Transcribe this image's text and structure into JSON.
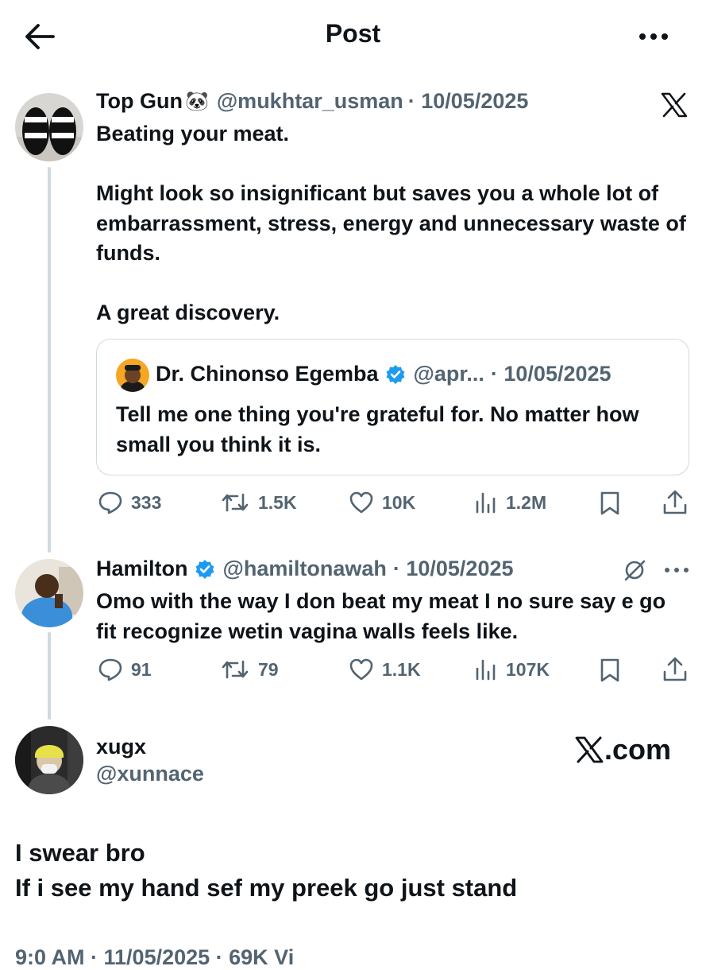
{
  "header": {
    "title": "Post"
  },
  "tweet1": {
    "name": "Top Gun",
    "emoji": "🐼",
    "handle": "@mukhtar_usman",
    "date": "· 10/05/2025",
    "text": "Beating your meat.\n\nMight look so insignificant but saves you a whole lot of embarrassment, stress, energy and unnecessary waste of funds.\n\nA great discovery.",
    "quote": {
      "name": "Dr. Chinonso Egemba",
      "handle": "@apr...",
      "date": "· 10/05/2025",
      "text": "Tell me one thing you're grateful for. No matter how small you think it is."
    },
    "metrics": {
      "replies": "333",
      "reposts": "1.5K",
      "likes": "10K",
      "views": "1.2M"
    }
  },
  "tweet2": {
    "name": "Hamilton",
    "handle": "@hamiltonawah",
    "date": "· 10/05/2025",
    "text": "Omo with the way I don beat my meat I no sure say e go fit recognize wetin vagina walls feels like.",
    "metrics": {
      "replies": "91",
      "reposts": "79",
      "likes": "1.1K",
      "views": "107K"
    }
  },
  "tweet3": {
    "name": "xugx",
    "handle": "@xunnace",
    "text": "I swear bro\nIf i see my hand sef my preek go just stand",
    "timestamp_partial": "9:0 AM · 11/05/2025 · 69K Vi"
  },
  "watermark": {
    "text": ".com"
  },
  "colors": {
    "verified": "#1d9bf0",
    "grey": "#536471",
    "border": "#cfd9de"
  },
  "icons": [
    "back-arrow-icon",
    "more-icon",
    "x-logo-icon",
    "verified-icon",
    "reply-icon",
    "repost-icon",
    "like-icon",
    "views-icon",
    "bookmark-icon",
    "share-icon",
    "grok-icon"
  ]
}
